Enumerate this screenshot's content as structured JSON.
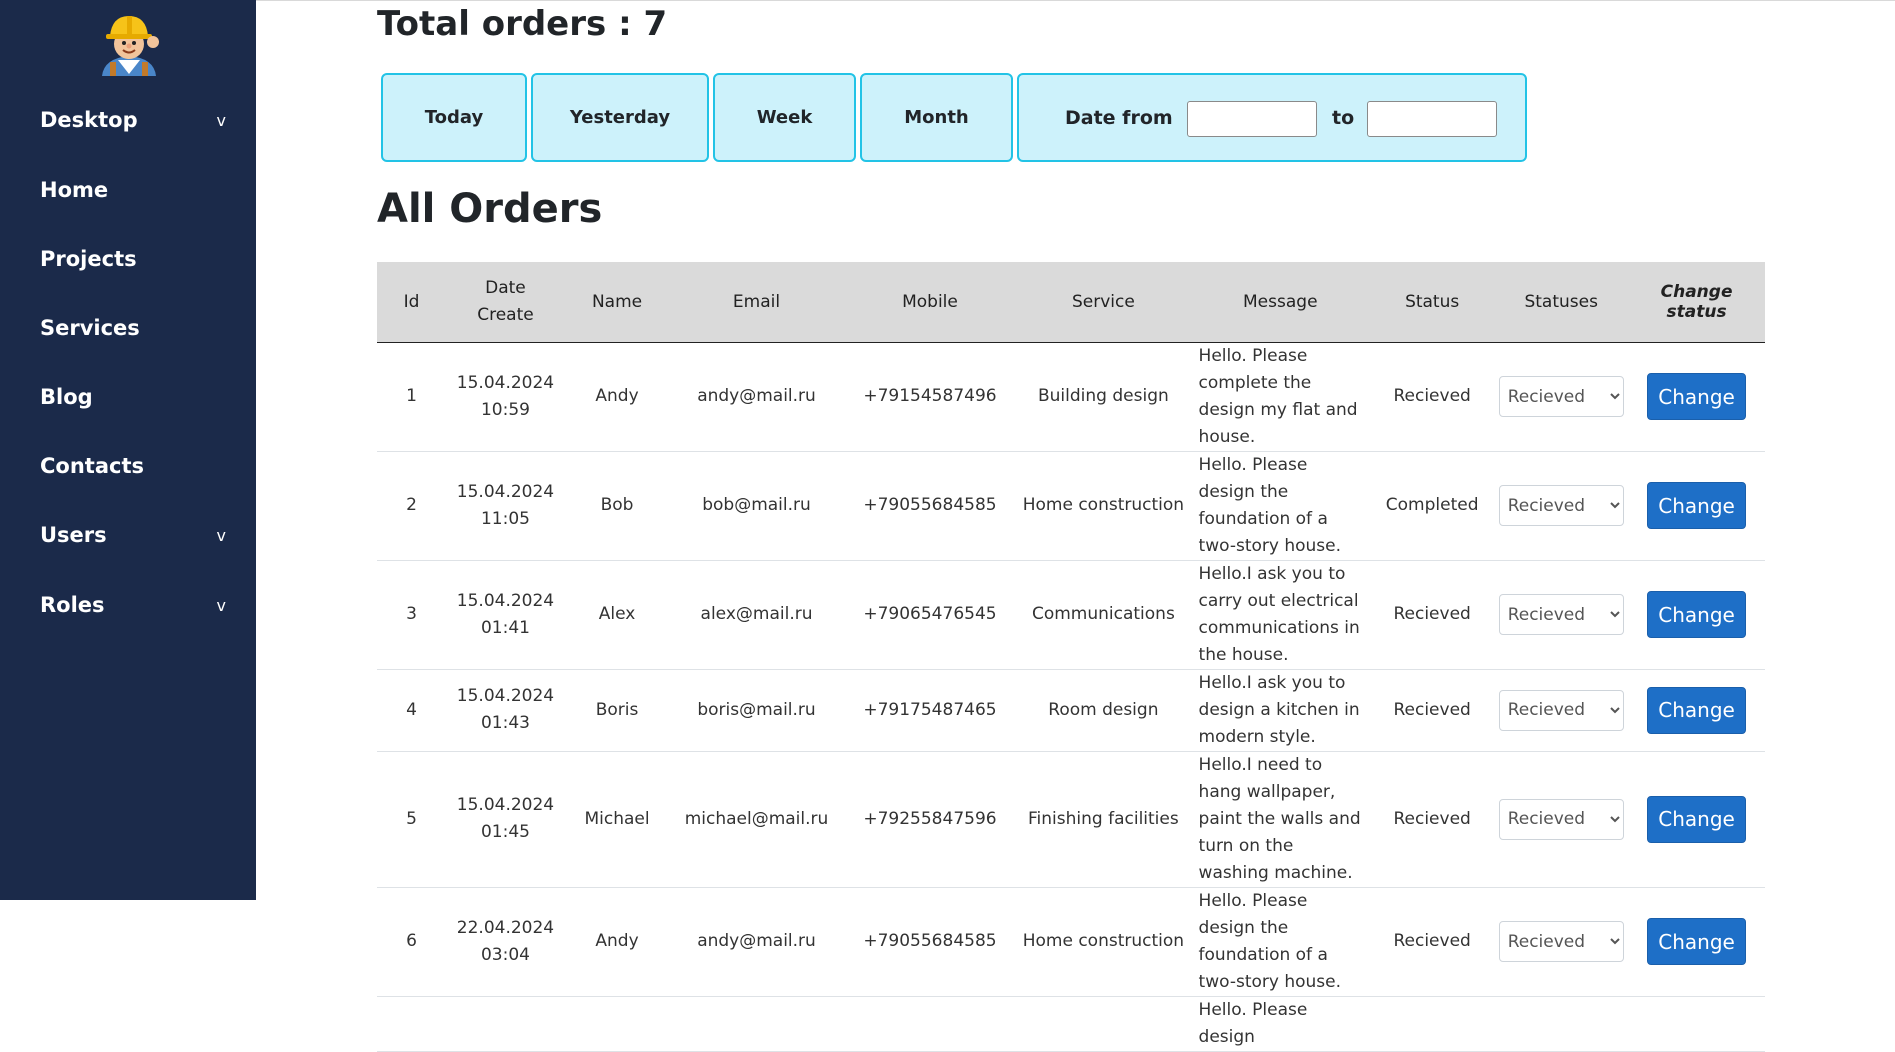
{
  "sidebar": {
    "logo": "builder-mascot-logo",
    "items": [
      {
        "label": "Desktop",
        "chevron": "v"
      },
      {
        "label": "Home",
        "chevron": ""
      },
      {
        "label": "Projects",
        "chevron": ""
      },
      {
        "label": "Services",
        "chevron": ""
      },
      {
        "label": "Blog",
        "chevron": ""
      },
      {
        "label": "Contacts",
        "chevron": ""
      },
      {
        "label": "Users",
        "chevron": "v"
      },
      {
        "label": "Roles",
        "chevron": "v"
      }
    ]
  },
  "main": {
    "total_label": "Total orders : 7",
    "filters": {
      "today": "Today",
      "yesterday": "Yesterday",
      "week": "Week",
      "month": "Month",
      "date_from": "Date from",
      "to": "to",
      "date_from_value": "",
      "date_to_value": ""
    },
    "heading": "All Orders",
    "table": {
      "headers": [
        "Id",
        "Date Create",
        "Name",
        "Email",
        "Mobile",
        "Service",
        "Message",
        "Status",
        "Statuses",
        "Change status"
      ],
      "rows": [
        {
          "id": "1",
          "date": "15.04.2024",
          "time": "10:59",
          "name": "Andy",
          "email": "andy@mail.ru",
          "mobile": "+79154587496",
          "service": "Building design",
          "message": "Hello. Please complete the design my flat and house.",
          "status": "Recieved",
          "statuses": "Recieved",
          "button": "Change"
        },
        {
          "id": "2",
          "date": "15.04.2024",
          "time": "11:05",
          "name": "Bob",
          "email": "bob@mail.ru",
          "mobile": "+79055684585",
          "service": "Home construction",
          "message": "Hello. Please design the foundation of a two-story house.",
          "status": "Completed",
          "statuses": "Recieved",
          "button": "Change"
        },
        {
          "id": "3",
          "date": "15.04.2024",
          "time": "01:41",
          "name": "Alex",
          "email": "alex@mail.ru",
          "mobile": "+79065476545",
          "service": "Communications",
          "message": "Hello.I ask you to carry out electrical communications in the house.",
          "status": "Recieved",
          "statuses": "Recieved",
          "button": "Change"
        },
        {
          "id": "4",
          "date": "15.04.2024",
          "time": "01:43",
          "name": "Boris",
          "email": "boris@mail.ru",
          "mobile": "+79175487465",
          "service": "Room design",
          "message": "Hello.I ask you to design a kitchen in modern style.",
          "status": "Recieved",
          "statuses": "Recieved",
          "button": "Change"
        },
        {
          "id": "5",
          "date": "15.04.2024",
          "time": "01:45",
          "name": "Michael",
          "email": "michael@mail.ru",
          "mobile": "+79255847596",
          "service": "Finishing facilities",
          "message": "Hello.I need to hang wallpaper, paint the walls and turn on the washing machine.",
          "status": "Recieved",
          "statuses": "Recieved",
          "button": "Change"
        },
        {
          "id": "6",
          "date": "22.04.2024",
          "time": "03:04",
          "name": "Andy",
          "email": "andy@mail.ru",
          "mobile": "+79055684585",
          "service": "Home construction",
          "message": "Hello. Please design the foundation of a two-story house.",
          "status": "Recieved",
          "statuses": "Recieved",
          "button": "Change"
        },
        {
          "id": "",
          "date": "",
          "time": "",
          "name": "",
          "email": "",
          "mobile": "",
          "service": "",
          "message": "Hello. Please design",
          "status": "",
          "statuses": "",
          "button": ""
        }
      ]
    }
  },
  "colors": {
    "sidebar_bg": "#1b2a4a",
    "filter_bg": "#cdf2fb",
    "filter_border": "#22c3e6",
    "table_header_bg": "#dadada",
    "button_blue": "#1e6fc7"
  }
}
